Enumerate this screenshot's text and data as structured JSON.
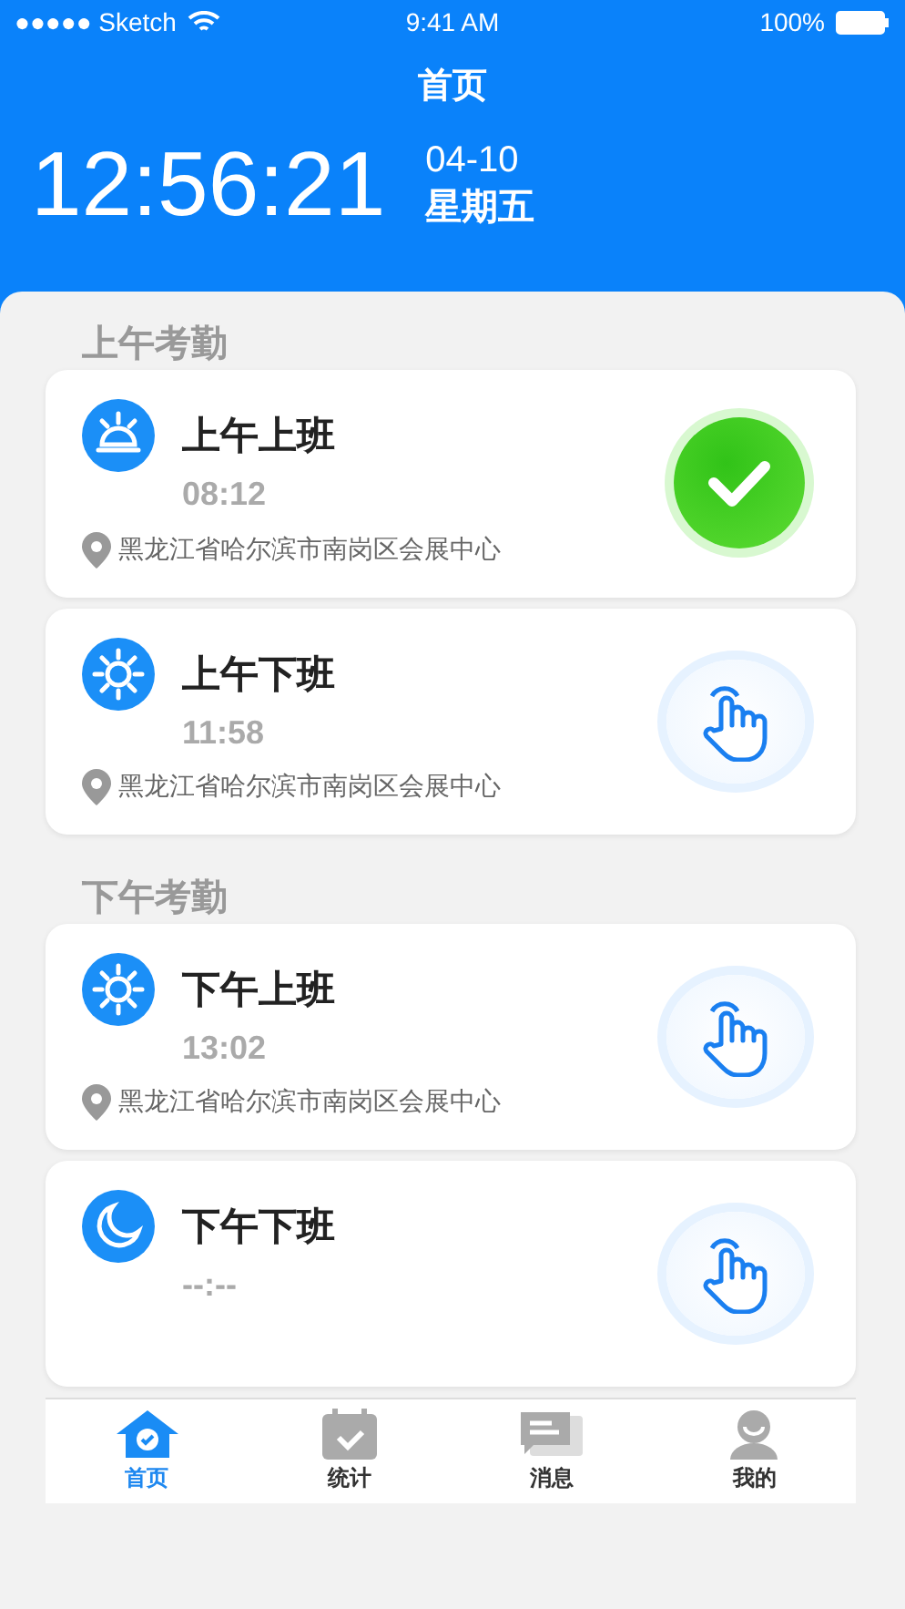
{
  "status_bar": {
    "carrier": "●●●●● Sketch",
    "time": "9:41  AM",
    "battery": "100%"
  },
  "header": {
    "title": "首页",
    "clock": "12:56:21",
    "date": "04-10",
    "weekday": "星期五"
  },
  "sections": [
    {
      "title": "上午考勤",
      "records": [
        {
          "kind": "sunrise",
          "label": "上午上班",
          "time": "08:12",
          "address": "黑龙江省哈尔滨市南岗区会展中心",
          "checked": true
        },
        {
          "kind": "sun",
          "label": "上午下班",
          "time": "11:58",
          "address": "黑龙江省哈尔滨市南岗区会展中心",
          "checked": false
        }
      ]
    },
    {
      "title": "下午考勤",
      "records": [
        {
          "kind": "sun",
          "label": "下午上班",
          "time": "13:02",
          "address": "黑龙江省哈尔滨市南岗区会展中心",
          "checked": false
        },
        {
          "kind": "moon",
          "label": "下午下班",
          "time": "--:--",
          "checked": false
        }
      ]
    }
  ],
  "tabs": [
    {
      "kind": "home",
      "label": "首页",
      "selected": true
    },
    {
      "kind": "calendar",
      "label": "统计",
      "selected": false
    },
    {
      "kind": "chat",
      "label": "消息",
      "selected": false
    },
    {
      "kind": "user",
      "label": "我的",
      "selected": false
    }
  ]
}
